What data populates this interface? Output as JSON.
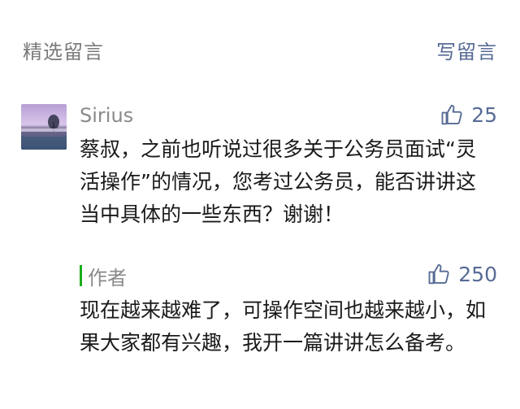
{
  "header": {
    "title": "精选留言",
    "write_label": "写留言"
  },
  "comment": {
    "author": "Sirius",
    "likes": "25",
    "text": "蔡叔，之前也听说过很多关于公务员面试“灵活操作”的情况，您考过公务员，能否讲讲这当中具体的一些东西？谢谢！"
  },
  "reply": {
    "author": "作者",
    "likes": "250",
    "text": "现在越来越难了，可操作空间也越来越小，如果大家都有兴趣，我开一篇讲讲怎么备考。"
  },
  "colors": {
    "link": "#576b95",
    "accent_bar": "#1aad19",
    "muted": "#8a8a8a"
  }
}
